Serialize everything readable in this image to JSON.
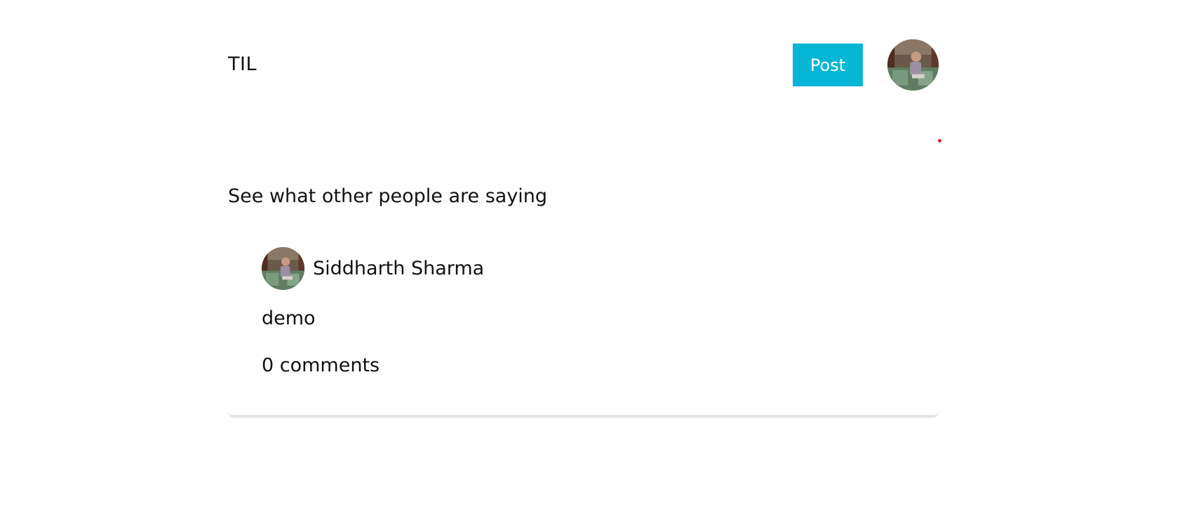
{
  "header": {
    "brand": "TIL",
    "post_button_label": "Post",
    "avatar_icon": "user-avatar-photo"
  },
  "feed": {
    "section_title": "See what other people are saying",
    "posts": [
      {
        "author": "Siddharth Sharma",
        "body": "demo",
        "comments_label": "0 comments"
      }
    ]
  },
  "colors": {
    "accent": "#06b6d4",
    "notification_dot": "#dc2626",
    "text": "#111111"
  }
}
